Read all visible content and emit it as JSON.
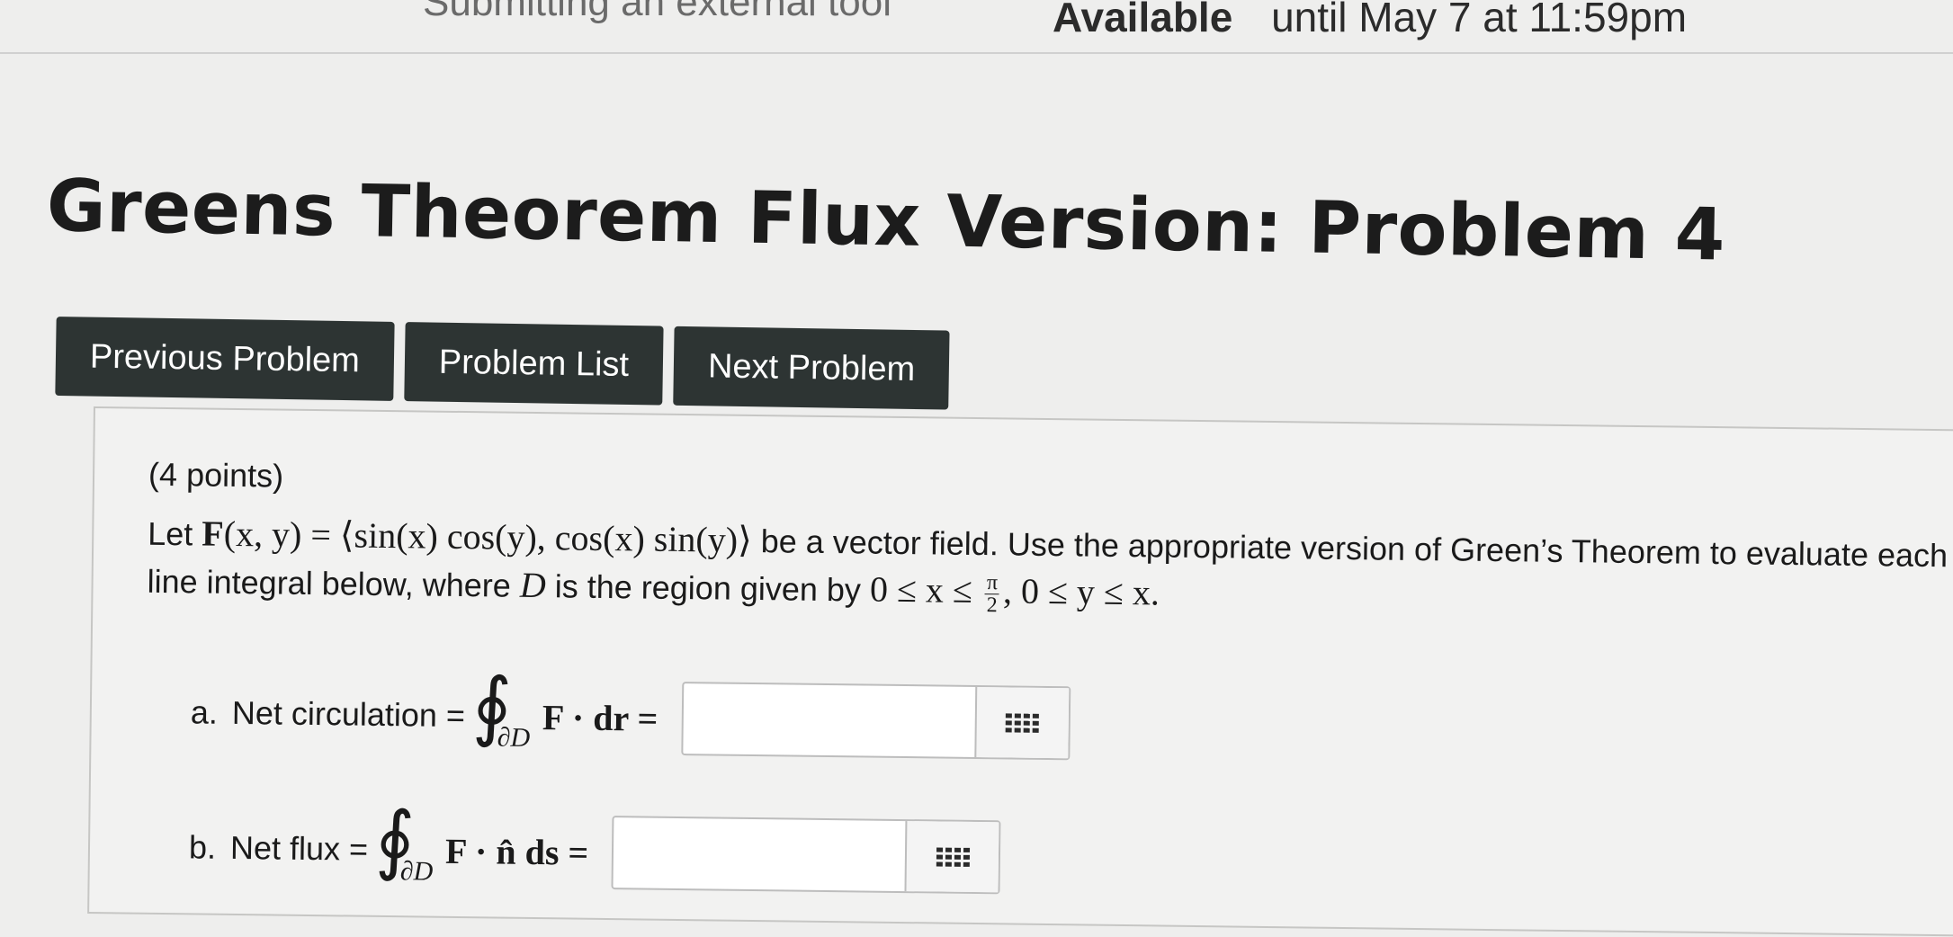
{
  "header": {
    "cut_text": "Submitting an external tool",
    "available_label": "Available",
    "available_date": "until May 7 at 11:59pm"
  },
  "title": "Greens Theorem Flux Version: Problem 4",
  "nav": {
    "previous": "Previous Problem",
    "list": "Problem List",
    "next": "Next Problem"
  },
  "problem": {
    "points": "(4 points)",
    "let": "Let",
    "field_lhs": "F",
    "field_args": "(x, y) = ⟨sin(x) cos(y), cos(x) sin(y)⟩",
    "text1": "be a vector field. Use the appropriate version of Green’s Theorem to evaluate each line integral below, where",
    "region_var": "D",
    "text2": "is the region given by",
    "cond1": "0 ≤ x ≤",
    "frac_num": "π",
    "frac_den": "2",
    "cond2": ", 0 ≤ y ≤ x.",
    "part_a": {
      "letter": "a.",
      "label": "Net circulation =",
      "integral": "∮",
      "subscript": "∂D",
      "integrand": "F · dr =",
      "value": ""
    },
    "part_b": {
      "letter": "b.",
      "label": "Net flux =",
      "integral": "∮",
      "subscript": "∂D",
      "integrand": "F · n̂ ds =",
      "value": ""
    }
  }
}
